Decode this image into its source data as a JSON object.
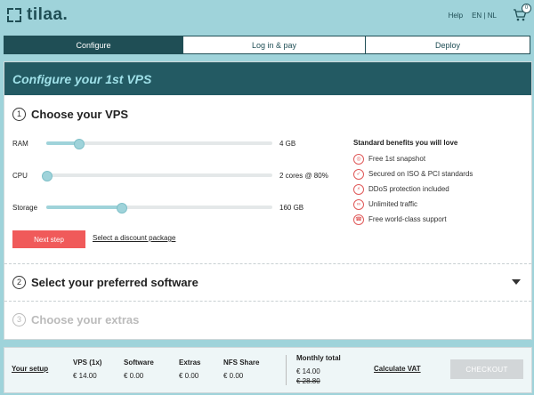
{
  "header": {
    "logo_text": "tilaa.",
    "help": "Help",
    "lang_en": "EN",
    "lang_sep": "|",
    "lang_nl": "NL",
    "cart_count": "0"
  },
  "steps": [
    {
      "label": "Configure",
      "active": true
    },
    {
      "label": "Log in & pay",
      "active": false
    },
    {
      "label": "Deploy",
      "active": false
    }
  ],
  "card": {
    "title": "Configure your 1st VPS",
    "section1": {
      "num": "1",
      "title": "Choose your VPS"
    },
    "sliders": [
      {
        "label": "RAM",
        "value": "4 GB",
        "level": 0.14
      },
      {
        "label": "CPU",
        "value": "2 cores @ 80%",
        "level": 0.0
      },
      {
        "label": "Storage",
        "value": "160 GB",
        "level": 0.33
      }
    ],
    "benefits_title": "Standard benefits you will love",
    "benefits": [
      {
        "icon": "snapshot-icon",
        "glyph": "◎",
        "text": "Free 1st snapshot"
      },
      {
        "icon": "shield-icon",
        "glyph": "✓",
        "text": "Secured on ISO & PCI standards"
      },
      {
        "icon": "ddos-icon",
        "glyph": "⚡",
        "text": "DDoS protection included"
      },
      {
        "icon": "infinity-icon",
        "glyph": "∞",
        "text": "Unlimited traffic"
      },
      {
        "icon": "support-icon",
        "glyph": "☎",
        "text": "Free world-class support"
      }
    ],
    "next_button": "Next step",
    "discount_link": "Select a discount package",
    "section2": {
      "num": "2",
      "title": "Select your preferred software"
    },
    "section3": {
      "num": "3",
      "title": "Choose your extras"
    }
  },
  "footer": {
    "setup": "Your setup",
    "columns": [
      {
        "header": "VPS (1x)",
        "value": "€ 14.00"
      },
      {
        "header": "Software",
        "value": "€ 0.00"
      },
      {
        "header": "Extras",
        "value": "€ 0.00"
      },
      {
        "header": "NFS Share",
        "value": "€ 0.00"
      }
    ],
    "monthly_title": "Monthly total",
    "monthly_value": "€ 14.00",
    "monthly_old": "€ 28.80",
    "calc_vat": "Calculate VAT",
    "checkout": "CHECKOUT"
  },
  "colors": {
    "brand_dark": "#1f4e55",
    "page_bg": "#9fd3da",
    "accent_red": "#f05a5a",
    "title_bar": "#235a63"
  }
}
